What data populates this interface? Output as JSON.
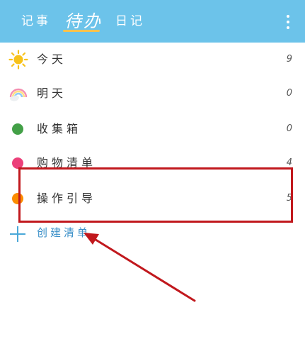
{
  "header": {
    "tabs": [
      {
        "label": "记事"
      },
      {
        "label": "待办"
      },
      {
        "label": "日记"
      }
    ],
    "active_tab": "待办",
    "background": "#6cc3ea",
    "accent": "#f6c24f"
  },
  "lists": [
    {
      "label": "今天",
      "count": "9",
      "icon": "sun-icon"
    },
    {
      "label": "明天",
      "count": "0",
      "icon": "rainbow-icon"
    },
    {
      "label": "收集箱",
      "count": "0",
      "icon": "green-dot-icon",
      "color": "#43a047"
    },
    {
      "label": "购物清单",
      "count": "4",
      "icon": "pink-dot-icon",
      "color": "#ec407a"
    },
    {
      "label": "操作引导",
      "count": "5",
      "icon": "orange-dot-icon",
      "color": "#fb8c00"
    }
  ],
  "create": {
    "label": "创建清单"
  },
  "annotation": {
    "box_color": "#c1181d",
    "arrow_color": "#c1181d"
  }
}
